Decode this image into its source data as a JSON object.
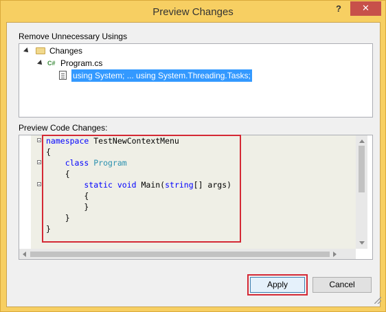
{
  "window": {
    "title": "Preview Changes",
    "help_label": "?",
    "close_label": "✕"
  },
  "tree": {
    "label": "Remove Unnecessary Usings",
    "root": "Changes",
    "file": "Program.cs",
    "file_badge": "C#",
    "change": "using System; ... using System.Threading.Tasks;"
  },
  "code": {
    "label": "Preview Code Changes:",
    "lines": {
      "l1_kw": "namespace",
      "l1_rest": " TestNewContextMenu",
      "l2": "{",
      "l3_kw": "    class",
      "l3_ty": " Program",
      "l4": "    {",
      "l5_kw": "        static",
      "l5_kw2": " void",
      "l5_rest": " Main(",
      "l5_kw3": "string",
      "l5_rest2": "[] args)",
      "l6": "        {",
      "l7": "        }",
      "l8": "    }",
      "l9": "}"
    }
  },
  "buttons": {
    "apply": "Apply",
    "cancel": "Cancel"
  },
  "colors": {
    "frame": "#f7cf62",
    "close": "#c7514a",
    "highlight": "#d42834",
    "selection": "#3399ff"
  }
}
